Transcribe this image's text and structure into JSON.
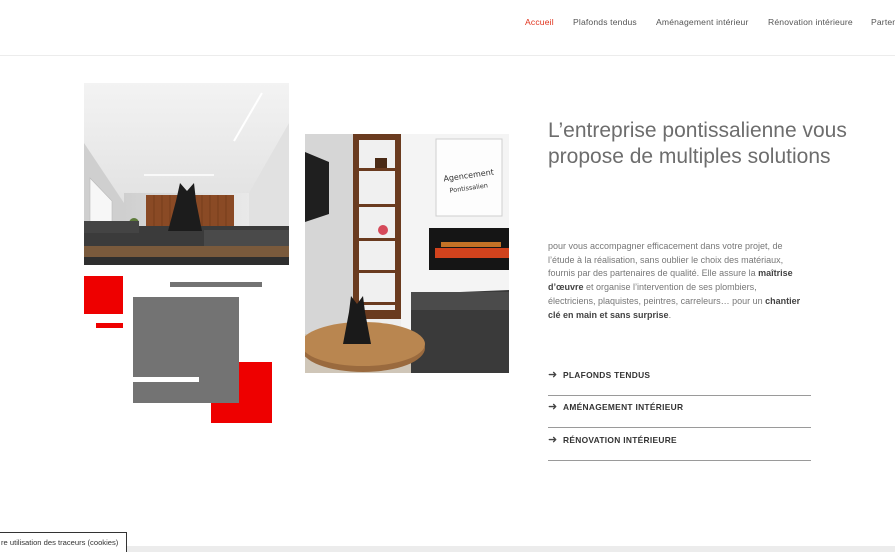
{
  "nav": {
    "items": [
      {
        "label": "Accueil",
        "active": true
      },
      {
        "label": "Plafonds tendus",
        "active": false
      },
      {
        "label": "Aménagement intérieur",
        "active": false
      },
      {
        "label": "Rénovation intérieure",
        "active": false
      },
      {
        "label": "Parten",
        "active": false
      }
    ]
  },
  "hero": {
    "heading": "L’entreprise pontissalienne vous propose de multiples solutions",
    "intro_part1": "pour vous accompagner efficacement dans votre projet, de l’étude à la réalisation, sans oublier le choix des matériaux, fournis par des partenaires de qualité. Elle assure la ",
    "intro_bold1": "maîtrise d’œuvre",
    "intro_part2": " et organise l’intervention de ses plombiers, électriciens, plaquistes, peintres, carreleurs… pour un ",
    "intro_bold2": "chantier clé en main et sans surprise",
    "intro_part3": "."
  },
  "services": [
    {
      "label": "PLAFONDS TENDUS",
      "icon": "arrow-right-icon"
    },
    {
      "label": "AMÉNAGEMENT INTÉRIEUR",
      "icon": "arrow-right-icon"
    },
    {
      "label": "RÉNOVATION INTÉRIEURE",
      "icon": "arrow-right-icon"
    }
  ],
  "photo2": {
    "sign_line1": "Agencement",
    "sign_line2": "Pontissalien"
  },
  "cookie": {
    "label": "re utilisation des traceurs (cookies)"
  },
  "colors": {
    "accent": "#e0331d",
    "red_block": "#ee0000",
    "gray_block": "#737373",
    "text": "#6d6d6d"
  }
}
